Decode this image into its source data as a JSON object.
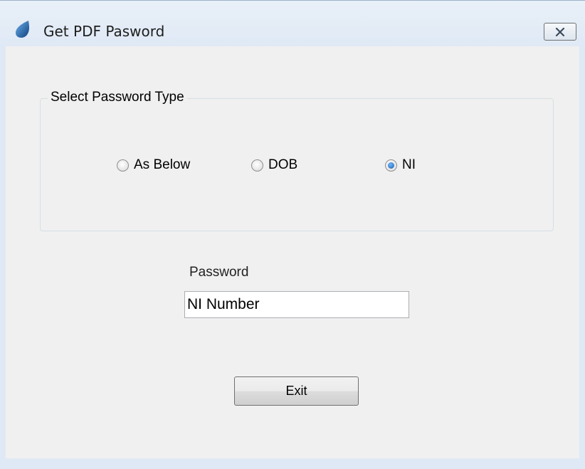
{
  "window": {
    "title": "Get PDF Pasword",
    "close_icon": "close-icon",
    "app_icon": "water-drop-icon",
    "accent_color": "#1f5fa8"
  },
  "group": {
    "label": "Select Password Type",
    "options": [
      {
        "label": "As Below",
        "checked": false
      },
      {
        "label": "DOB",
        "checked": false
      },
      {
        "label": "NI",
        "checked": true
      }
    ]
  },
  "password": {
    "label": "Password",
    "value": "NI Number"
  },
  "buttons": {
    "exit_label": "Exit"
  }
}
